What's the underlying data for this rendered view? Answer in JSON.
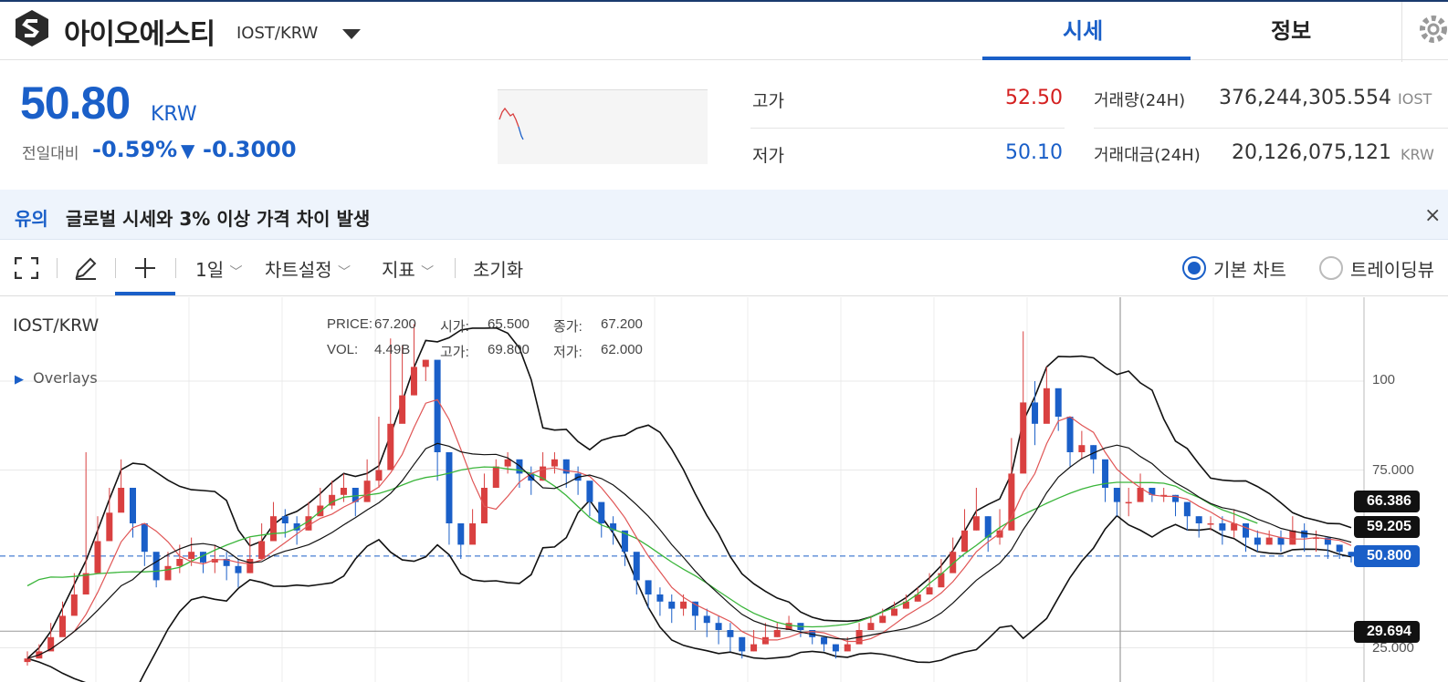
{
  "header": {
    "coin_name": "아이오에스티",
    "coin_pair": "IOST/KRW",
    "tabs": [
      {
        "label": "시세"
      },
      {
        "label": "정보"
      }
    ]
  },
  "price": {
    "value": "50.80",
    "unit": "KRW",
    "change_label": "전일대비",
    "change_pct": "-0.59%",
    "change_arrow": "▼",
    "change_val": "-0.3000"
  },
  "stats": {
    "high_label": "고가",
    "high": "52.50",
    "low_label": "저가",
    "low": "50.10",
    "volume_label": "거래량(24H)",
    "volume": "376,244,305.554",
    "volume_unit": "IOST",
    "amount_label": "거래대금(24H)",
    "amount": "20,126,075,121",
    "amount_unit": "KRW"
  },
  "notice": {
    "tag": "유의",
    "text": "글로벌 시세와 3% 이상 가격 차이 발생",
    "close": "×"
  },
  "toolbar": {
    "interval": "1일",
    "chart_settings": "차트설정",
    "indicators": "지표",
    "reset": "초기화",
    "radio_basic": "기본 차트",
    "radio_trading": "트레이딩뷰"
  },
  "chart": {
    "title": "IOST/KRW",
    "overlays": "Overlays",
    "ohlc": {
      "price_label": "PRICE:",
      "price": "67.200",
      "open_label": "시가:",
      "open": "65.500",
      "close_label": "종가:",
      "close": "67.200",
      "vol_label": "VOL:",
      "vol": "4.49B",
      "high_label": "고가:",
      "high": "69.800",
      "low_label": "저가:",
      "low": "62.000"
    },
    "y_ticks": [
      "100",
      "75.000",
      "25.000"
    ],
    "tags": {
      "bb_upper": "66.386",
      "ma": "59.205",
      "current": "50.800",
      "min": "29.694"
    },
    "colors": {
      "up": "#d94040",
      "down": "#1a5fc8",
      "ma_green": "#3ab53a",
      "ma_red": "#e05555",
      "band": "#111111"
    }
  },
  "chart_data": {
    "type": "candlestick",
    "title": "IOST/KRW",
    "ylim": [
      20,
      120
    ],
    "y_ticks": [
      25,
      75,
      100
    ],
    "current": 50.8,
    "markers": [
      66.386,
      59.205,
      50.8,
      29.694
    ],
    "closes": [
      22,
      24,
      28,
      34,
      40,
      46,
      55,
      63,
      70,
      60,
      52,
      44,
      48,
      50,
      52,
      49,
      50,
      48,
      46,
      50,
      55,
      62,
      60,
      58,
      62,
      65,
      68,
      70,
      66,
      72,
      75,
      88,
      96,
      104,
      106,
      80,
      60,
      54,
      60,
      70,
      76,
      78,
      74,
      72,
      76,
      78,
      74,
      72,
      66,
      60,
      58,
      52,
      44,
      40,
      38,
      36,
      38,
      34,
      32,
      30,
      28,
      24,
      26,
      28,
      30,
      32,
      30,
      28,
      26,
      24,
      26,
      30,
      32,
      34,
      36,
      38,
      40,
      42,
      46,
      52,
      58,
      62,
      56,
      58,
      74,
      94,
      88,
      98,
      90,
      80,
      82,
      78,
      70,
      66,
      66,
      70,
      68,
      68,
      66,
      62,
      60,
      60,
      58,
      60,
      56,
      54,
      56,
      54,
      58,
      56,
      56,
      54,
      52,
      50.8
    ],
    "highs": [
      24,
      26,
      32,
      38,
      46,
      80,
      62,
      70,
      78,
      66,
      58,
      50,
      52,
      54,
      56,
      52,
      54,
      52,
      50,
      56,
      60,
      66,
      64,
      62,
      66,
      70,
      72,
      74,
      70,
      78,
      90,
      112,
      110,
      116,
      106,
      88,
      66,
      60,
      64,
      74,
      78,
      80,
      76,
      76,
      80,
      80,
      78,
      76,
      70,
      64,
      62,
      56,
      48,
      44,
      42,
      40,
      40,
      38,
      36,
      34,
      32,
      28,
      30,
      32,
      32,
      34,
      32,
      30,
      28,
      26,
      28,
      32,
      34,
      36,
      38,
      40,
      42,
      46,
      50,
      56,
      64,
      70,
      62,
      64,
      84,
      114,
      100,
      104,
      96,
      86,
      86,
      82,
      74,
      70,
      70,
      74,
      70,
      70,
      68,
      66,
      62,
      62,
      62,
      64,
      58,
      58,
      58,
      58,
      62,
      60,
      58,
      56,
      54,
      52
    ],
    "lows": [
      20,
      22,
      26,
      30,
      36,
      42,
      50,
      58,
      64,
      56,
      48,
      42,
      44,
      46,
      48,
      46,
      46,
      44,
      42,
      46,
      50,
      58,
      56,
      54,
      58,
      62,
      64,
      66,
      62,
      66,
      70,
      80,
      90,
      96,
      100,
      72,
      54,
      50,
      56,
      66,
      72,
      74,
      70,
      68,
      72,
      74,
      70,
      68,
      62,
      56,
      54,
      48,
      40,
      36,
      34,
      32,
      34,
      30,
      28,
      26,
      24,
      22,
      24,
      26,
      28,
      30,
      28,
      26,
      24,
      22,
      24,
      28,
      30,
      32,
      34,
      36,
      38,
      40,
      44,
      48,
      54,
      58,
      52,
      54,
      68,
      86,
      82,
      92,
      86,
      76,
      78,
      74,
      66,
      62,
      62,
      66,
      66,
      66,
      62,
      58,
      56,
      58,
      54,
      56,
      52,
      52,
      54,
      52,
      54,
      52,
      52,
      50,
      50,
      49
    ]
  }
}
